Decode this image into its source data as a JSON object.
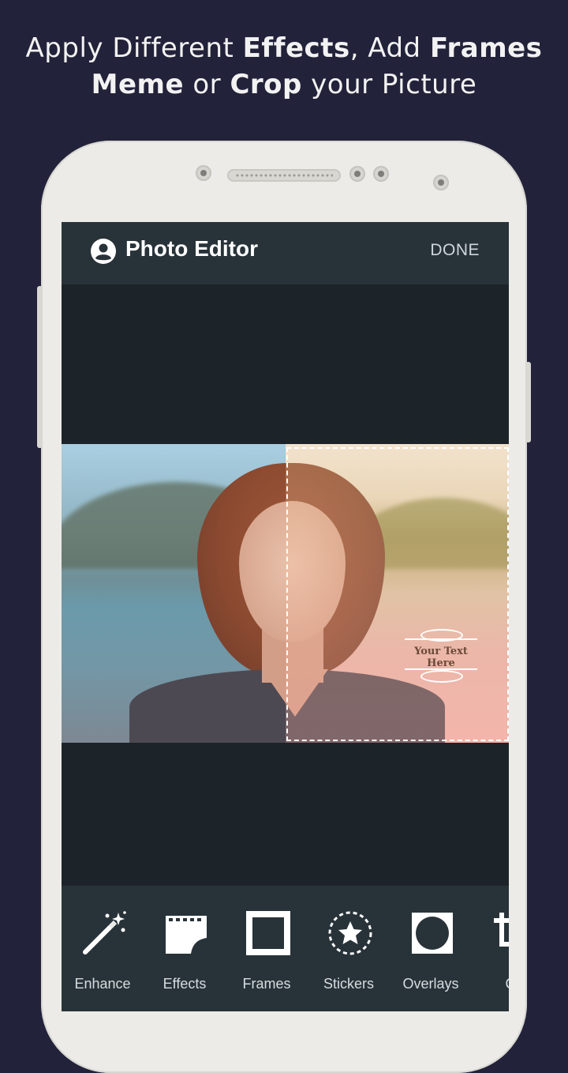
{
  "headline": {
    "line1": [
      "Apply Different ",
      "Effects",
      ", Add ",
      "Frames"
    ],
    "line2": [
      "Meme",
      " or ",
      "Crop",
      " your Picture"
    ]
  },
  "appbar": {
    "title": "Photo Editor",
    "done_label": "DONE"
  },
  "meme": {
    "text": "Your Text Here"
  },
  "toolbar": {
    "items": [
      {
        "label": "Enhance",
        "icon": "magic-wand-icon"
      },
      {
        "label": "Effects",
        "icon": "film-effect-icon"
      },
      {
        "label": "Frames",
        "icon": "frame-icon"
      },
      {
        "label": "Stickers",
        "icon": "star-sticker-icon"
      },
      {
        "label": "Overlays",
        "icon": "overlay-icon"
      },
      {
        "label": "Cr",
        "icon": "crop-icon"
      }
    ]
  },
  "colors": {
    "background": "#22223a",
    "phone_body": "#ecebe7",
    "appbar": "#283339",
    "screen": "#1d2429"
  }
}
